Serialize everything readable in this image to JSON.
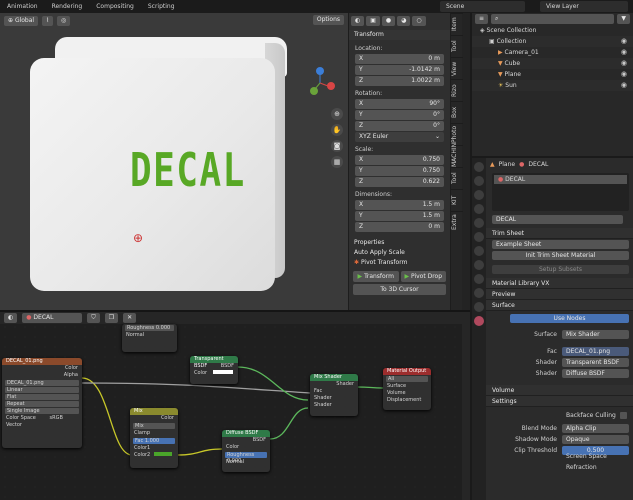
{
  "topbar": {
    "tabs": [
      "Animation",
      "Rendering",
      "Compositing",
      "Scripting"
    ],
    "scene": "Scene",
    "view_layer": "View Layer"
  },
  "viewport": {
    "orientation": "Global",
    "options": "Options",
    "decal_text": "DECAL"
  },
  "npanel": {
    "transform_title": "Transform",
    "location_label": "Location:",
    "location": [
      {
        "axis": "X",
        "val": "0 m"
      },
      {
        "axis": "Y",
        "val": "-1.0142 m"
      },
      {
        "axis": "Z",
        "val": "1.0022 m"
      }
    ],
    "rotation_label": "Rotation:",
    "rotation": [
      {
        "axis": "X",
        "val": "90°"
      },
      {
        "axis": "Y",
        "val": "0°"
      },
      {
        "axis": "Z",
        "val": "0°"
      }
    ],
    "rotation_mode": "XYZ Euler",
    "scale_label": "Scale:",
    "scale": [
      {
        "axis": "X",
        "val": "0.750"
      },
      {
        "axis": "Y",
        "val": "0.750"
      },
      {
        "axis": "Z",
        "val": "0.622"
      }
    ],
    "dimensions_label": "Dimensions:",
    "dimensions": [
      {
        "axis": "X",
        "val": "1.5 m"
      },
      {
        "axis": "Y",
        "val": "1.5 m"
      },
      {
        "axis": "Z",
        "val": "0 m"
      }
    ],
    "properties": "Properties",
    "auto_apply": "Auto Apply Scale",
    "pivot_transform": "Pivot Transform",
    "transform_btn": "Transform",
    "pivot_drop_btn": "Pivot Drop",
    "to_3d_cursor_btn": "To 3D Cursor"
  },
  "sidetabs": [
    "Item",
    "Tool",
    "View",
    "Rizo",
    "Box",
    "Photo",
    "MACHIN",
    "Tool",
    "KIT",
    "Extra"
  ],
  "outliner": {
    "items": [
      {
        "name": "Scene Collection",
        "indent": 0
      },
      {
        "name": "Collection",
        "indent": 1
      },
      {
        "name": "Camera_01",
        "indent": 2
      },
      {
        "name": "Cube",
        "indent": 2
      },
      {
        "name": "Plane",
        "indent": 2
      },
      {
        "name": "Sun",
        "indent": 2
      }
    ]
  },
  "properties": {
    "object": "Plane",
    "material": "DECAL",
    "slot": "DECAL",
    "material_field": "DECAL",
    "trim_sheet": "Trim Sheet",
    "example_sheet": "Example Sheet",
    "init_trim": "Init Trim Sheet Material",
    "setup_subsets": "Setup Subsets",
    "material_library": "Material Library VX",
    "preview": "Preview",
    "surface": "Surface",
    "use_nodes": "Use Nodes",
    "surface_label": "Surface",
    "surface_val": "Mix Shader",
    "fac_label": "Fac",
    "fac_val": "DECAL_01.png",
    "shader1_label": "Shader",
    "shader1_val": "Transparent BSDF",
    "shader2_label": "Shader",
    "shader2_val": "Diffuse BSDF",
    "volume": "Volume",
    "settings": "Settings",
    "backface": "Backface Culling",
    "blend_label": "Blend Mode",
    "blend_val": "Alpha Clip",
    "shadow_label": "Shadow Mode",
    "shadow_val": "Opaque",
    "clip_label": "Clip Threshold",
    "clip_val": "0.500",
    "ssr": "Screen Space Refraction"
  },
  "nodes": {
    "header_material": "DECAL",
    "image_node": {
      "title": "DECAL_01.png",
      "out_color": "Color",
      "out_alpha": "Alpha",
      "image": "DECAL_01.png",
      "interp": "Linear",
      "proj": "Flat",
      "ext": "Repeat",
      "src": "Single Image",
      "cs_label": "Color Space",
      "cs_val": "sRGB",
      "vector": "Vector"
    },
    "top_node": {
      "f1": "Roughness",
      "f1v": "0.000",
      "normal": "Normal"
    },
    "transparent": {
      "title": "Transparent BSDF",
      "bsdf": "BSDF",
      "color": "Color"
    },
    "mix": {
      "title": "Mix",
      "color": "Color",
      "mix": "Mix",
      "clamp": "Clamp",
      "fac": "Fac",
      "facv": "1.000",
      "c1": "Color1",
      "c2": "Color2"
    },
    "diffuse": {
      "title": "Diffuse BSDF",
      "bsdf": "BSDF",
      "color": "Color",
      "rough": "Roughness",
      "roughv": "0.000",
      "normal": "Normal"
    },
    "mixshader": {
      "title": "Mix Shader",
      "shader": "Shader",
      "fac": "Fac",
      "s1": "Shader",
      "s2": "Shader"
    },
    "output": {
      "title": "Material Output",
      "target": "All",
      "surface": "Surface",
      "volume": "Volume",
      "disp": "Displacement"
    }
  }
}
